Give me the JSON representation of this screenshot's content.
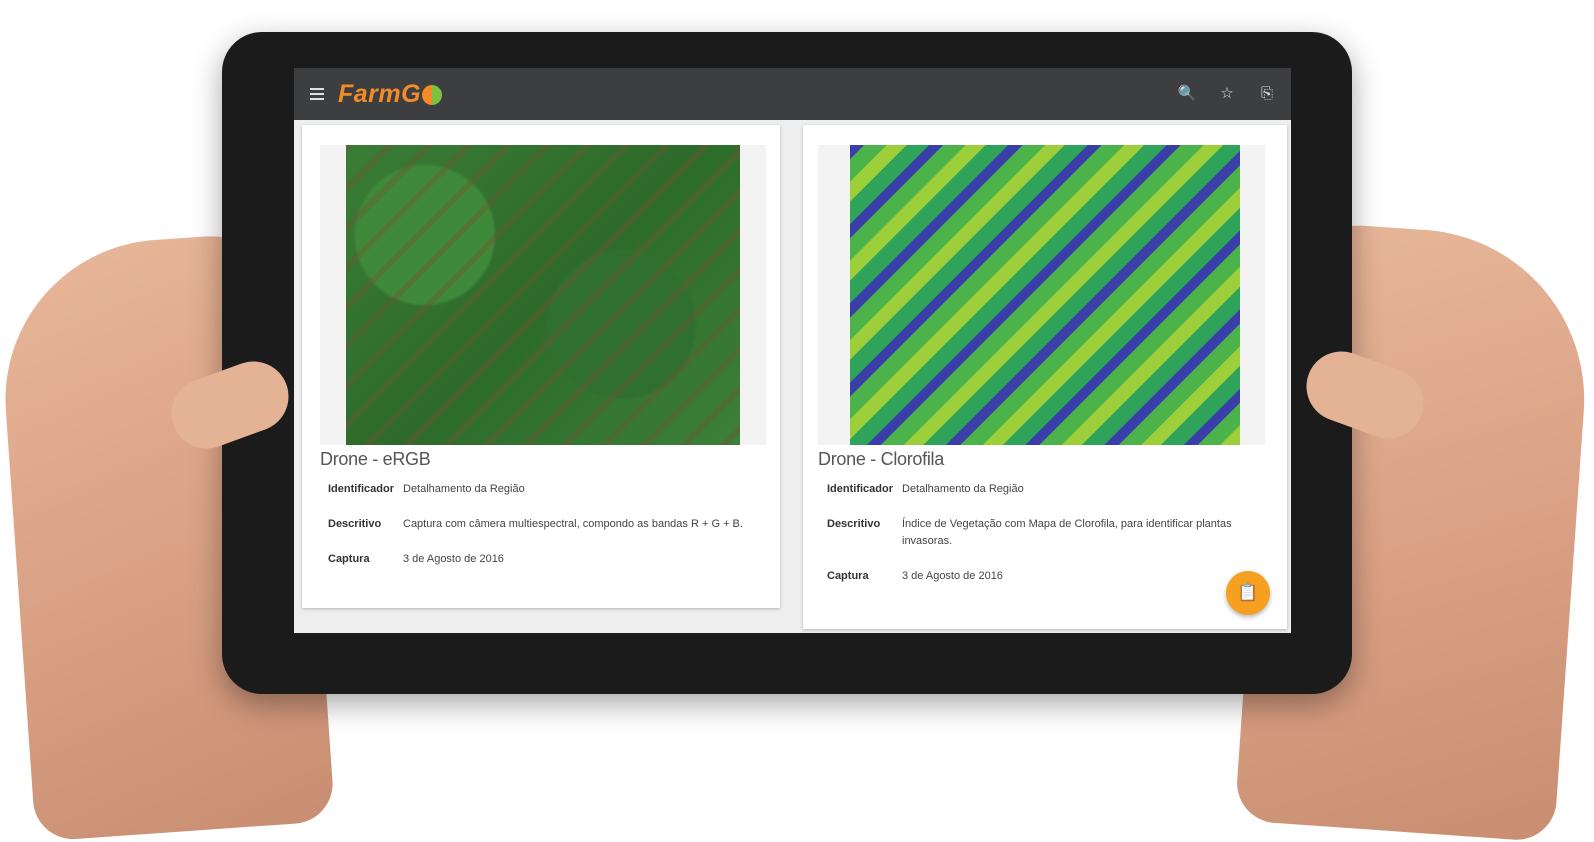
{
  "app": {
    "logo_text": "FarmG",
    "toolbar": {
      "icons": [
        "menu-icon",
        "search-icon",
        "star-icon",
        "exit-icon"
      ],
      "menu_glyph": "≡",
      "search_glyph": "🔍",
      "star_glyph": "☆",
      "exit_glyph": "⎘"
    },
    "brand_color": "#f28c28"
  },
  "cards": [
    {
      "title": "Drone - eRGB",
      "rows": [
        {
          "label": "Identificador",
          "value": "Detalhamento da Região"
        },
        {
          "label": "Descritivo",
          "value": "Captura com câmera multiespectral, compondo as bandas R + G + B."
        },
        {
          "label": "Captura",
          "value": "3 de Agosto de 2016"
        }
      ]
    },
    {
      "title": "Drone - Clorofila",
      "rows": [
        {
          "label": "Identificador",
          "value": "Detalhamento da Região"
        },
        {
          "label": "Descritivo",
          "value": "Índice de Vegetação com Mapa de Clorofila, para identificar plantas invasoras."
        },
        {
          "label": "Captura",
          "value": "3 de Agosto de 2016"
        }
      ],
      "fab_icon": "clipboard-icon",
      "fab_glyph": "📋",
      "fab_color": "#f5a020"
    }
  ]
}
